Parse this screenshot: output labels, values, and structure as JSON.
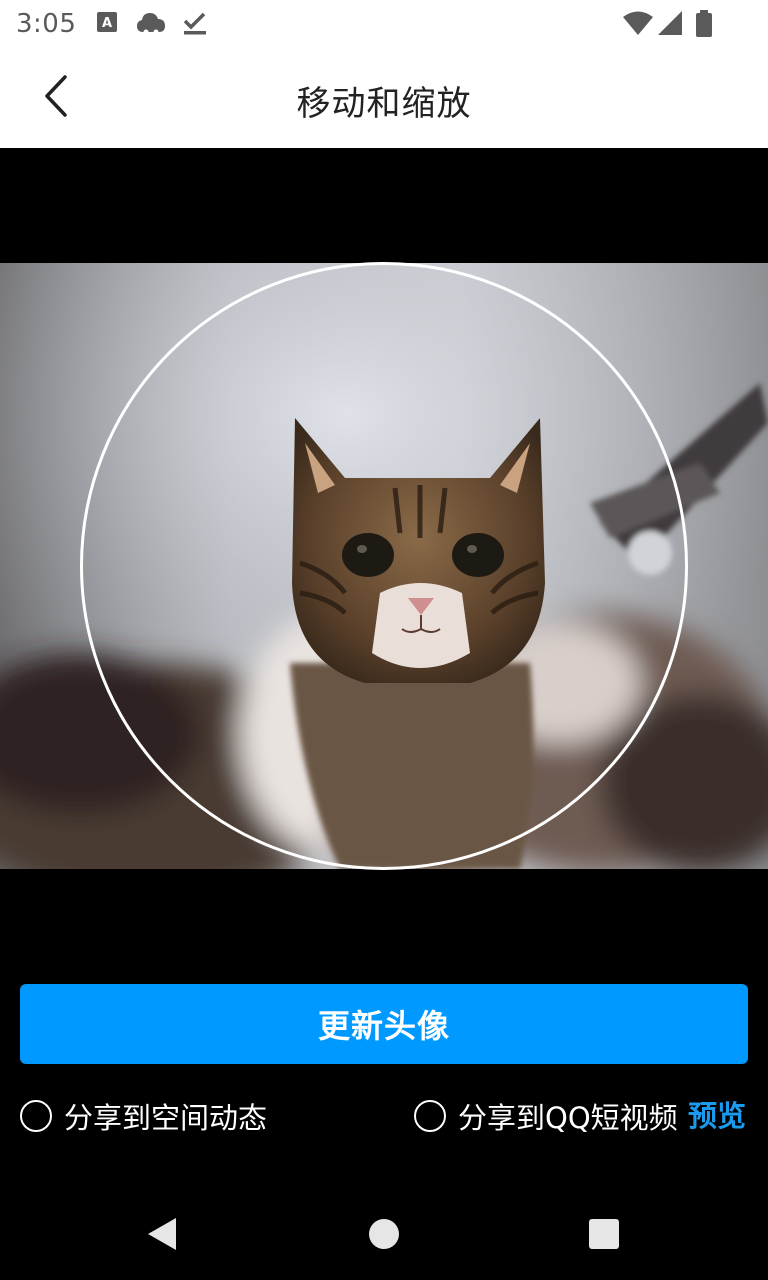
{
  "status_bar": {
    "time": "3:05",
    "left_icons": [
      "app-font-icon",
      "cloud-icon",
      "download-done-icon"
    ],
    "right_icons": [
      "wifi-icon",
      "cell-signal-icon",
      "battery-icon"
    ]
  },
  "header": {
    "back_icon": "chevron-left-icon",
    "title": "移动和缩放"
  },
  "editor": {
    "photo_subject": "cat-photo",
    "update_button_label": "更新头像",
    "share_options": [
      {
        "label": "分享到空间动态",
        "checked": false
      },
      {
        "label": "分享到QQ短视频",
        "checked": false
      }
    ],
    "preview_label": "预览"
  },
  "nav_bar": {
    "icons": [
      "nav-back-icon",
      "nav-home-icon",
      "nav-recents-icon"
    ]
  },
  "colors": {
    "accent": "#0099ff",
    "link": "#1b9bf0",
    "background": "#000000",
    "header_bg": "#ffffff"
  }
}
